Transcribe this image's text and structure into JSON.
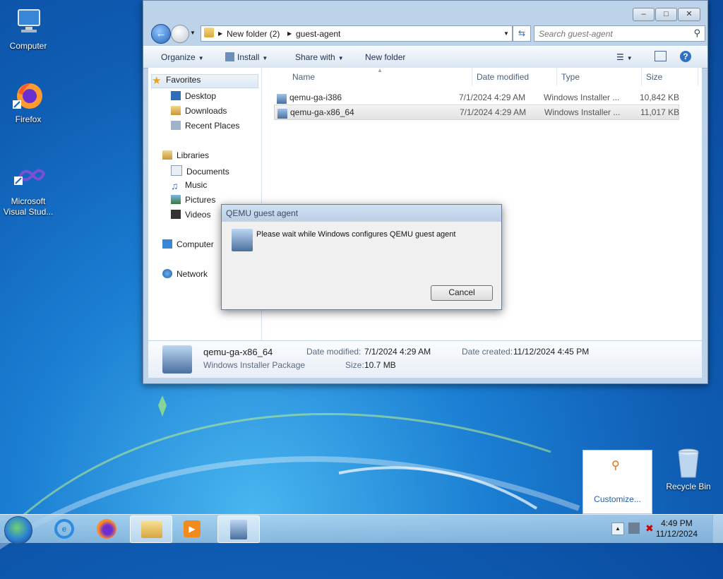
{
  "desktop": {
    "icons": [
      {
        "label": "Computer",
        "icon": "computer-icon"
      },
      {
        "label": "Firefox",
        "icon": "firefox-icon"
      },
      {
        "label": "Microsoft Visual Stud...",
        "icon": "visual-studio-icon"
      },
      {
        "label": "Recycle Bin",
        "icon": "recycle-bin-icon"
      }
    ]
  },
  "explorer": {
    "caption_buttons": {
      "minimize": "–",
      "maximize": "□",
      "close": "✕"
    },
    "breadcrumb": [
      "New folder (2)",
      "guest-agent"
    ],
    "search_placeholder": "Search guest-agent",
    "commands": {
      "organize": "Organize",
      "install": "Install",
      "share_with": "Share with",
      "new_folder": "New folder"
    },
    "nav": {
      "favorites": "Favorites",
      "desktop": "Desktop",
      "downloads": "Downloads",
      "recent_places": "Recent Places",
      "libraries": "Libraries",
      "documents": "Documents",
      "music": "Music",
      "pictures": "Pictures",
      "videos": "Videos",
      "computer": "Computer",
      "network": "Network"
    },
    "columns": {
      "name": "Name",
      "date_modified": "Date modified",
      "type": "Type",
      "size": "Size"
    },
    "files": [
      {
        "name": "qemu-ga-i386",
        "date_modified": "7/1/2024 4:29 AM",
        "type": "Windows Installer ...",
        "size": "10,842 KB"
      },
      {
        "name": "qemu-ga-x86_64",
        "date_modified": "7/1/2024 4:29 AM",
        "type": "Windows Installer ...",
        "size": "11,017 KB"
      }
    ],
    "details": {
      "name": "qemu-ga-x86_64",
      "type": "Windows Installer Package",
      "date_modified_label": "Date modified:",
      "date_modified": "7/1/2024 4:29 AM",
      "size_label": "Size:",
      "size": "10.7 MB",
      "date_created_label": "Date created:",
      "date_created": "11/12/2024 4:45 PM"
    }
  },
  "dialog": {
    "title": "QEMU guest agent",
    "message": "Please wait while Windows configures QEMU guest agent",
    "cancel": "Cancel"
  },
  "notification": {
    "link": "Customize..."
  },
  "taskbar": {
    "clock_time": "4:49 PM",
    "clock_date": "11/12/2024",
    "pinned": [
      "internet-explorer-icon",
      "firefox-icon",
      "explorer-icon",
      "media-player-icon",
      "installer-icon"
    ]
  }
}
